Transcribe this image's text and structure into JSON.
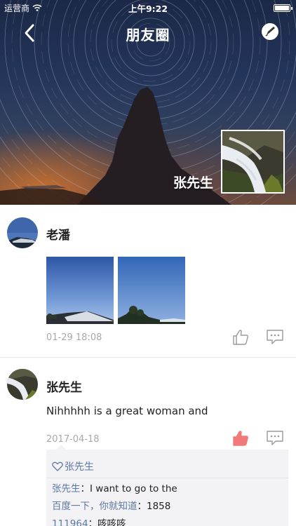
{
  "status_bar": {
    "carrier": "运营商",
    "time": "上午9:22"
  },
  "nav": {
    "title": "朋友圈"
  },
  "cover": {
    "owner_name": "张先生"
  },
  "posts": [
    {
      "author": "老潘",
      "timestamp": "01-29 18:08",
      "photo_count": 2,
      "liked": false
    },
    {
      "author": "张先生",
      "text": "Nihhhhh is a great woman and",
      "timestamp": "2017-04-18",
      "liked": true,
      "likes": [
        "张先生"
      ],
      "comments": [
        {
          "author": "张先生",
          "separator": "：",
          "text": "I want to go to the"
        },
        {
          "author": "百度一下，你就知道",
          "separator": "：",
          "text": "1858"
        },
        {
          "author": "111964",
          "separator": "：",
          "text": "咳咳咳"
        }
      ]
    }
  ],
  "colors": {
    "link": "#5b78a5",
    "like_active": "#f07a7a",
    "icon_gray": "#9a9a9a",
    "timestamp": "#a9a9a9"
  }
}
